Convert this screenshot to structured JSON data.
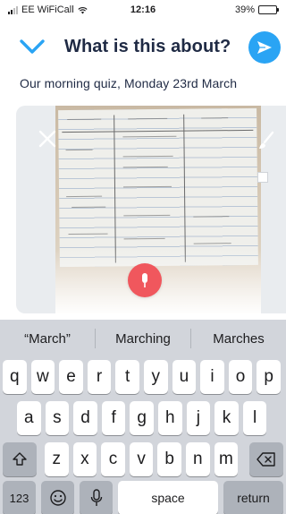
{
  "status_bar": {
    "carrier": "EE WiFiCall",
    "time": "12:16",
    "battery_percent": "39%",
    "battery_level": 0.39
  },
  "header": {
    "title": "What is this about?",
    "back_icon": "chevron-down-icon",
    "send_icon": "send-icon",
    "accent_color": "#2aa4f4"
  },
  "caption": {
    "text": "Our morning quiz, Monday 23rd March"
  },
  "photo": {
    "close_icon": "close-icon",
    "edit_icon": "brush-icon"
  },
  "mic": {
    "icon": "microphone-icon",
    "color": "#f0575d"
  },
  "keyboard": {
    "suggestions": [
      "“March”",
      "Marching",
      "Marches"
    ],
    "row1": [
      "q",
      "w",
      "e",
      "r",
      "t",
      "y",
      "u",
      "i",
      "o",
      "p"
    ],
    "row2": [
      "a",
      "s",
      "d",
      "f",
      "g",
      "h",
      "j",
      "k",
      "l"
    ],
    "row3": [
      "z",
      "x",
      "c",
      "v",
      "b",
      "n",
      "m"
    ],
    "numbers_label": "123",
    "space_label": "space",
    "return_label": "return"
  }
}
